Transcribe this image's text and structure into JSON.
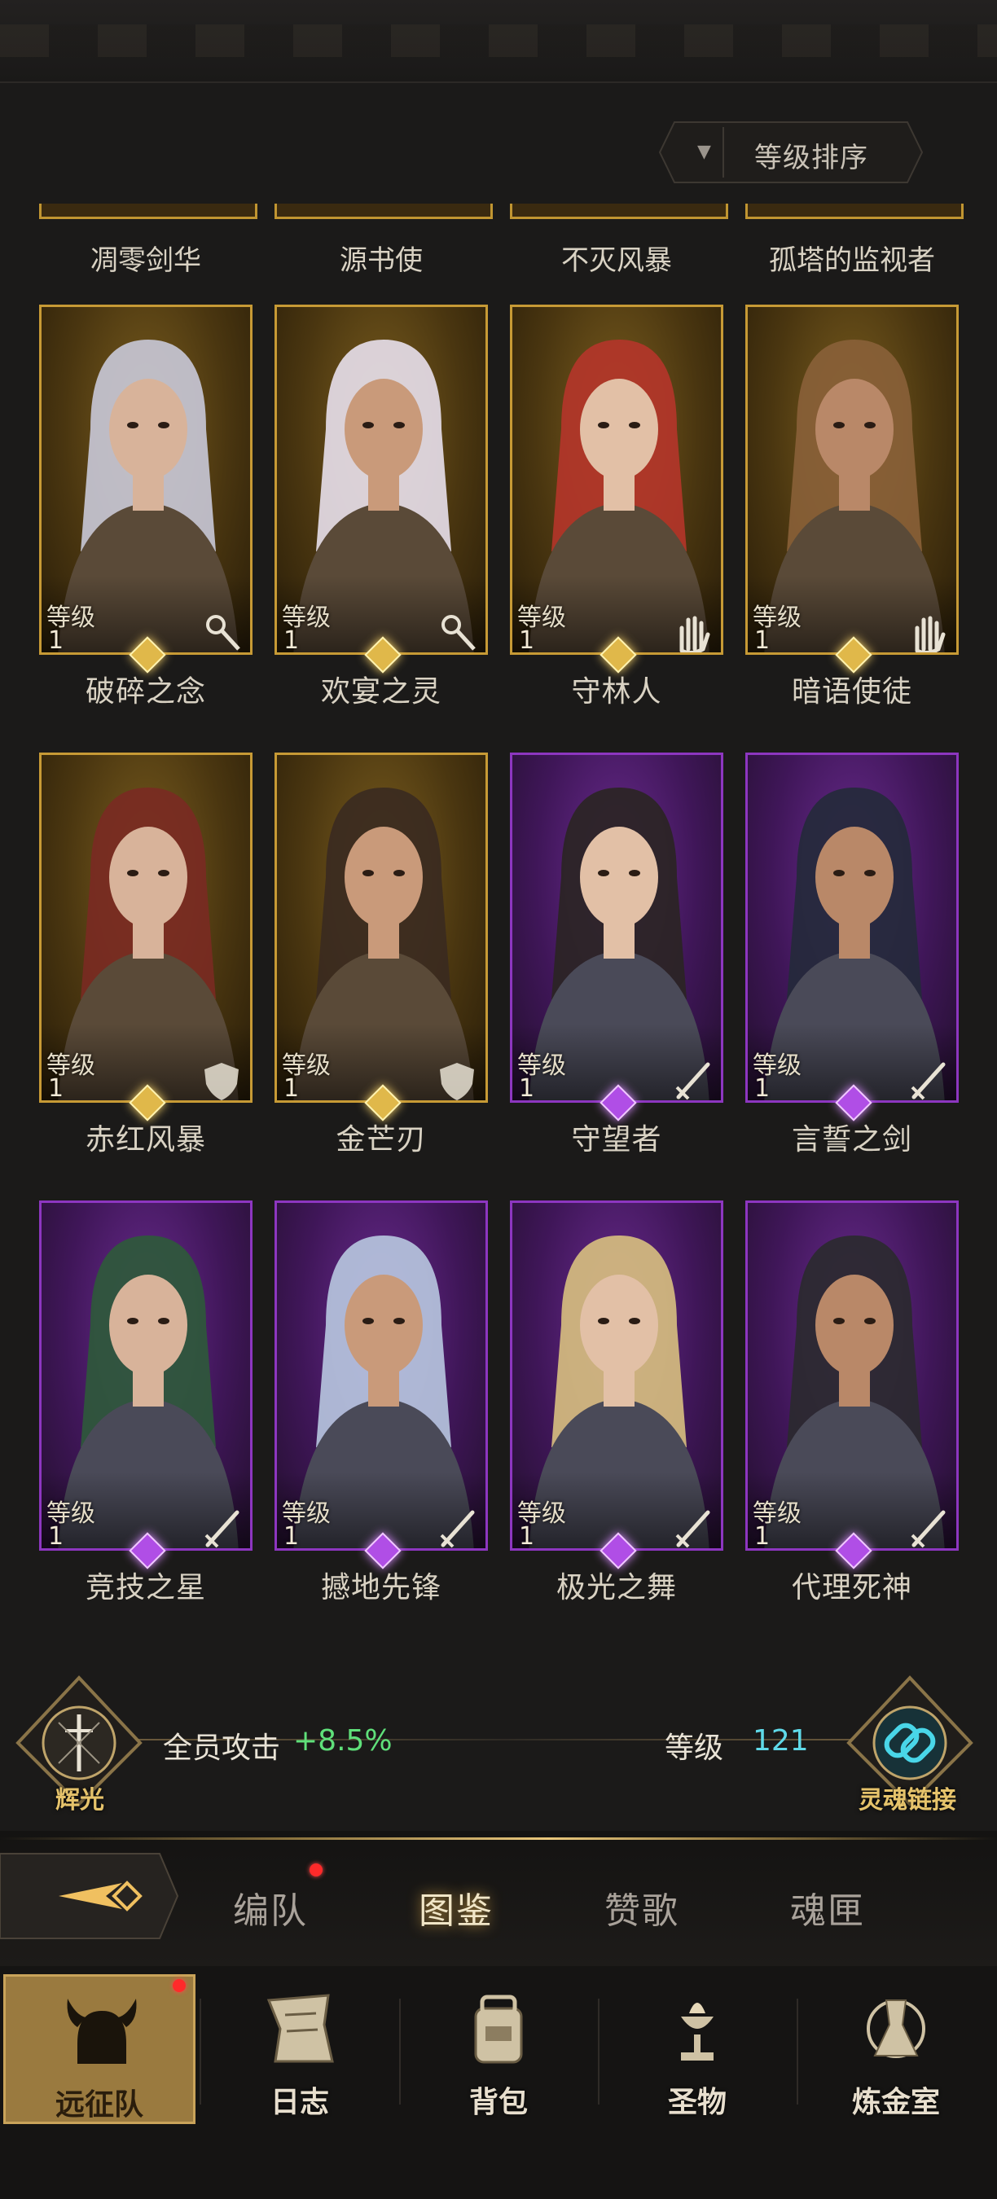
{
  "sort_button": {
    "label": "等级排序"
  },
  "top_row_names": [
    "凋零剑华",
    "源书使",
    "不灭风暴",
    "孤塔的监视者"
  ],
  "level_label": "等级",
  "heroes": [
    {
      "name": "破碎之念",
      "level": "1",
      "rarity": "gold",
      "class_icon": "staff-icon"
    },
    {
      "name": "欢宴之灵",
      "level": "1",
      "rarity": "gold",
      "class_icon": "staff-icon"
    },
    {
      "name": "守林人",
      "level": "1",
      "rarity": "gold",
      "class_icon": "hand-icon"
    },
    {
      "name": "暗语使徒",
      "level": "1",
      "rarity": "gold",
      "class_icon": "hand-icon"
    },
    {
      "name": "赤红风暴",
      "level": "1",
      "rarity": "gold",
      "class_icon": "shield-icon"
    },
    {
      "name": "金芒刃",
      "level": "1",
      "rarity": "gold",
      "class_icon": "shield-icon"
    },
    {
      "name": "守望者",
      "level": "1",
      "rarity": "purple",
      "class_icon": "sword-icon"
    },
    {
      "name": "言誓之剑",
      "level": "1",
      "rarity": "purple",
      "class_icon": "sword-icon"
    },
    {
      "name": "竞技之星",
      "level": "1",
      "rarity": "purple",
      "class_icon": "sword-icon"
    },
    {
      "name": "撼地先锋",
      "level": "1",
      "rarity": "purple",
      "class_icon": "sword-icon"
    },
    {
      "name": "极光之舞",
      "level": "1",
      "rarity": "purple",
      "class_icon": "sword-icon"
    },
    {
      "name": "代理死神",
      "level": "1",
      "rarity": "purple",
      "class_icon": "sword-icon"
    }
  ],
  "status": {
    "radiance_label": "辉光",
    "attack_label": "全员攻击",
    "attack_value": "+8.5%",
    "level_label": "等级",
    "level_value": "121",
    "soul_link_label": "灵魂链接"
  },
  "tabs": [
    {
      "label": "编队",
      "has_badge": true
    },
    {
      "label": "图鉴",
      "active": true
    },
    {
      "label": "赞歌"
    },
    {
      "label": "魂匣"
    }
  ],
  "nav": [
    {
      "label": "远征队",
      "icon": "viking-helmet-icon",
      "active": true,
      "has_badge": true
    },
    {
      "label": "日志",
      "icon": "scroll-icon"
    },
    {
      "label": "背包",
      "icon": "bag-icon"
    },
    {
      "label": "圣物",
      "icon": "chalice-icon"
    },
    {
      "label": "炼金室",
      "icon": "alchemy-icon"
    }
  ],
  "colors": {
    "gold_frame": "#c79a35",
    "purple_frame": "#8d36c0",
    "attack_green": "#5fe07a",
    "level_cyan": "#5fd9e8"
  }
}
